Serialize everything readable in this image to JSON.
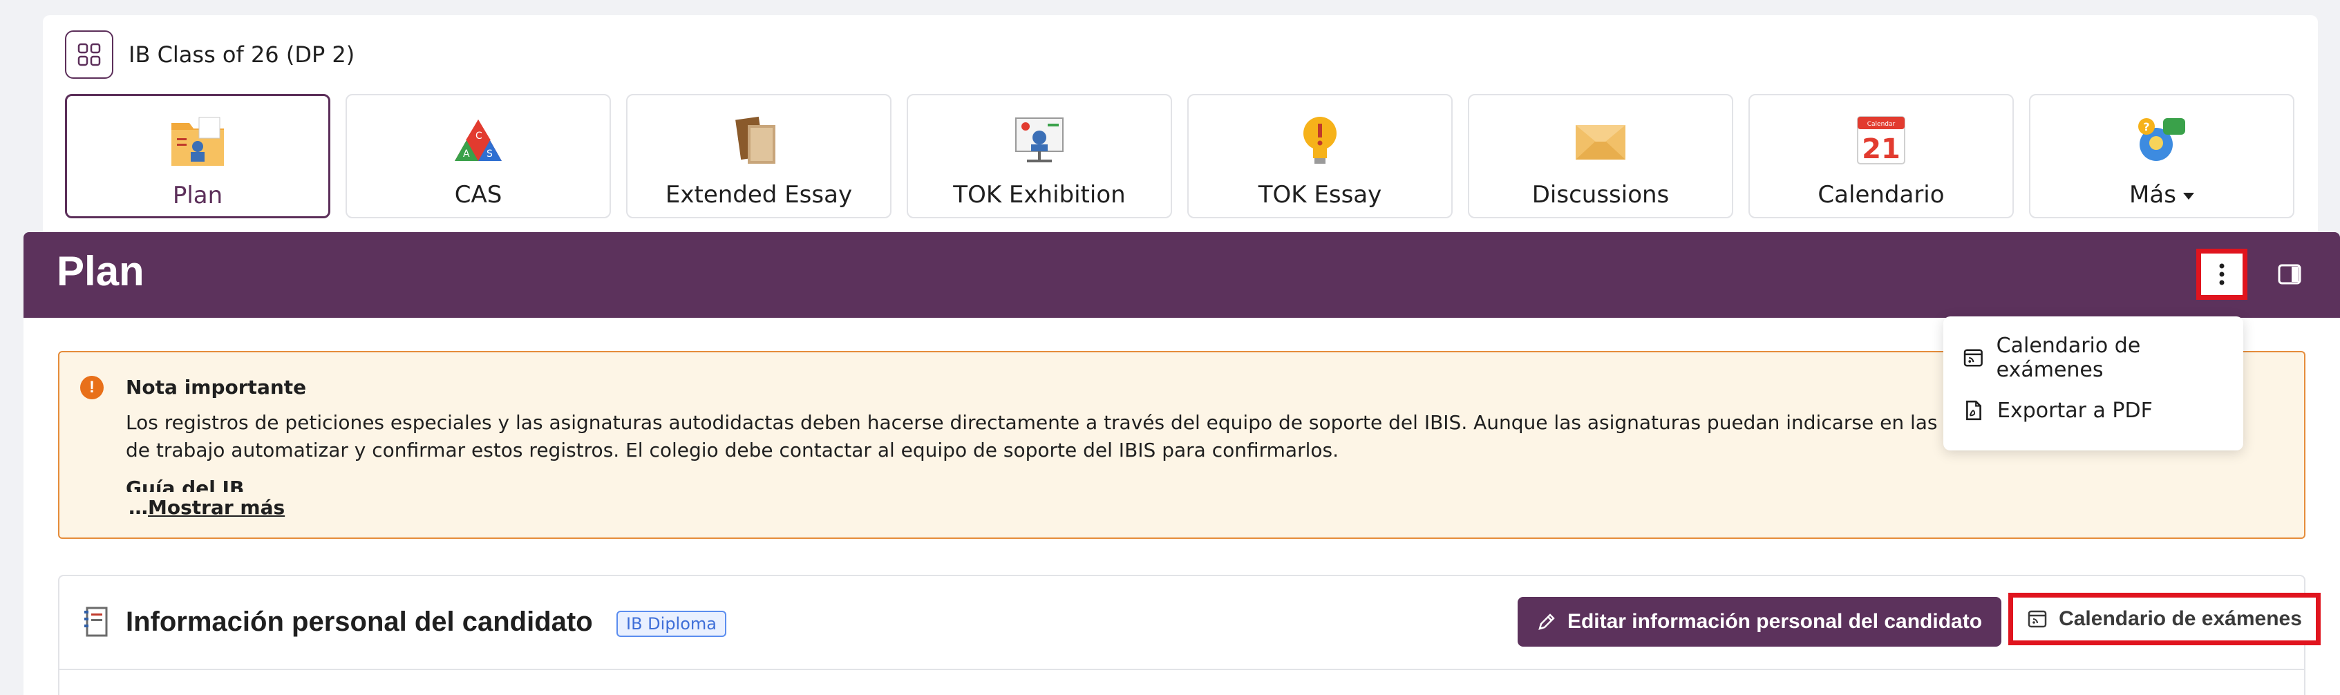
{
  "class_header": {
    "title": "IB Class of 26 (DP 2)"
  },
  "tiles": [
    {
      "label": "Plan",
      "icon": "plan-folder-icon",
      "active": true
    },
    {
      "label": "CAS",
      "icon": "cas-triangle-icon",
      "active": false
    },
    {
      "label": "Extended Essay",
      "icon": "books-icon",
      "active": false
    },
    {
      "label": "TOK Exhibition",
      "icon": "presentation-board-icon",
      "active": false
    },
    {
      "label": "TOK Essay",
      "icon": "lightbulb-icon",
      "active": false
    },
    {
      "label": "Discussions",
      "icon": "envelope-icon",
      "active": false
    },
    {
      "label": "Calendario",
      "icon": "calendar-21-icon",
      "active": false,
      "calendar_day": "21",
      "calendar_header": "Calendar"
    },
    {
      "label": "Más",
      "icon": "chat-bubbles-icon",
      "active": false,
      "has_caret": true
    }
  ],
  "plan_bar": {
    "title": "Plan"
  },
  "dropdown": {
    "items": [
      {
        "label": "Calendario de exámenes",
        "icon": "calendar-feed-icon"
      },
      {
        "label": "Exportar a PDF",
        "icon": "pdf-file-icon"
      }
    ]
  },
  "notice": {
    "title": "Nota importante",
    "body": "Los registros de peticiones especiales y las asignaturas autodidactas deben hacerse directamente a través del equipo de soporte del IBIS. Aunque las asignaturas puedan indicarse en las hojas de trabajo automatizar y confirmar estos registros. El colegio debe contactar al equipo de soporte del IBIS para confirmarlos.",
    "subheading": "Guía del IB",
    "more_prefix": "…",
    "more_label": "Mostrar más"
  },
  "section": {
    "title": "Información personal del candidato",
    "badge": "IB Diploma",
    "edit_button": "Editar información personal del candidato",
    "calendar_button": "Calendario de exámenes"
  },
  "colors": {
    "brand": "#5c325c",
    "highlight": "#e0141e",
    "notice_bg": "#fdf5e6",
    "notice_border": "#e58c3a",
    "badge": "#3f6fd8"
  }
}
